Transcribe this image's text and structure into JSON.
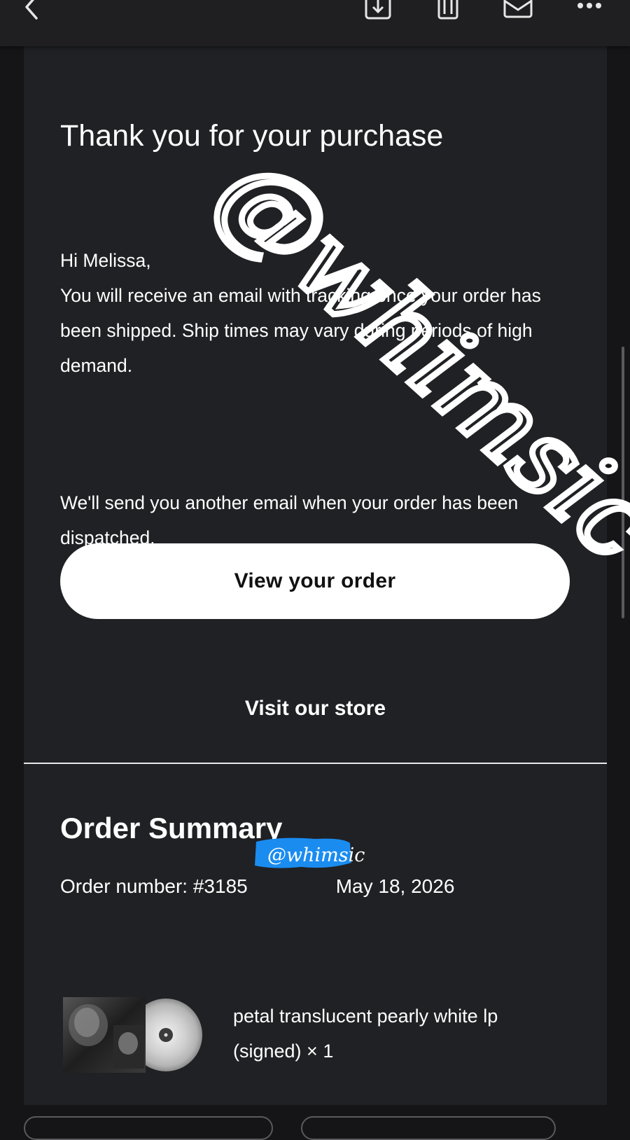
{
  "toolbar": {
    "icons": [
      "chevron-left-icon",
      "archive-icon",
      "trash-icon",
      "mail-icon",
      "more-icon"
    ]
  },
  "email": {
    "title": "Thank you for your purchase",
    "greeting": "Hi Melissa,",
    "shipping_message": "You will receive an email with tracking once your order has been shipped. Ship times may vary during periods of high demand.",
    "dispatch_message": "We'll send you another email when your order has been dispatched.",
    "view_order_label": "View your order",
    "visit_store_label": "Visit our store"
  },
  "summary": {
    "heading": "Order Summary",
    "order_number": "Order number: #3185",
    "order_date": "May 18, 2026",
    "item": {
      "name": "petal translucent pearly white lp (signed) × 1"
    }
  },
  "watermark": {
    "text": "@whimsic",
    "highlight_color": "#1a8cf0"
  }
}
